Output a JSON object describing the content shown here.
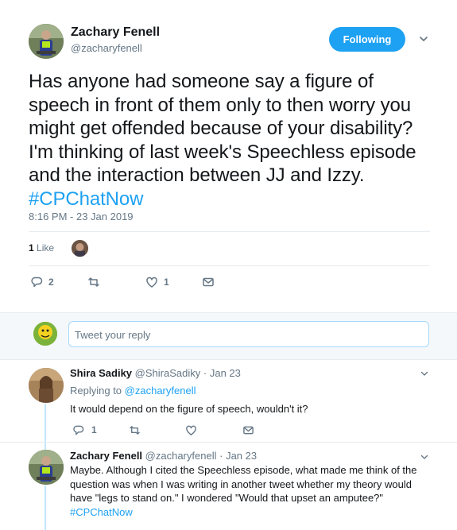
{
  "tweet": {
    "author_name": "Zachary Fenell",
    "author_handle": "@zacharyfenell",
    "follow_label": "Following",
    "text": "Has anyone had someone say a figure of speech in front of them only to then worry you might get offended because of your disability? I'm thinking of last week's Speechless episode and the interaction between JJ and Izzy.",
    "hashtag": "#CPChatNow",
    "timestamp": "8:16 PM - 23 Jan 2019",
    "like_count": "1",
    "like_label": "Like",
    "reply_count": "2",
    "retweet_count": "",
    "heart_count": "1"
  },
  "reply_box": {
    "placeholder": "Tweet your reply"
  },
  "replies": [
    {
      "name": "Shira Sadiky",
      "handle": "@ShiraSadiky",
      "sep": "·",
      "date": "Jan 23",
      "replying_prefix": "Replying to",
      "replying_to": "@zacharyfenell",
      "text": "It would depend on the figure of speech, wouldn't it?",
      "reply_count": "1"
    },
    {
      "name": "Zachary Fenell",
      "handle": "@zacharyfenell",
      "sep": "·",
      "date": "Jan 23",
      "text": "Maybe. Although I cited the Speechless episode, what made me think of the question was when I was writing in another tweet whether my theory would have \"legs to stand on.\" I wondered \"Would that upset an amputee?\"",
      "hashtag": "#CPChatNow"
    }
  ],
  "colors": {
    "accent": "#1da1f2",
    "text": "#14171a",
    "muted": "#657786",
    "divider": "#e6ecf0"
  },
  "icons": [
    "reply-icon",
    "retweet-icon",
    "heart-icon",
    "message-icon",
    "chevron-down-icon"
  ]
}
